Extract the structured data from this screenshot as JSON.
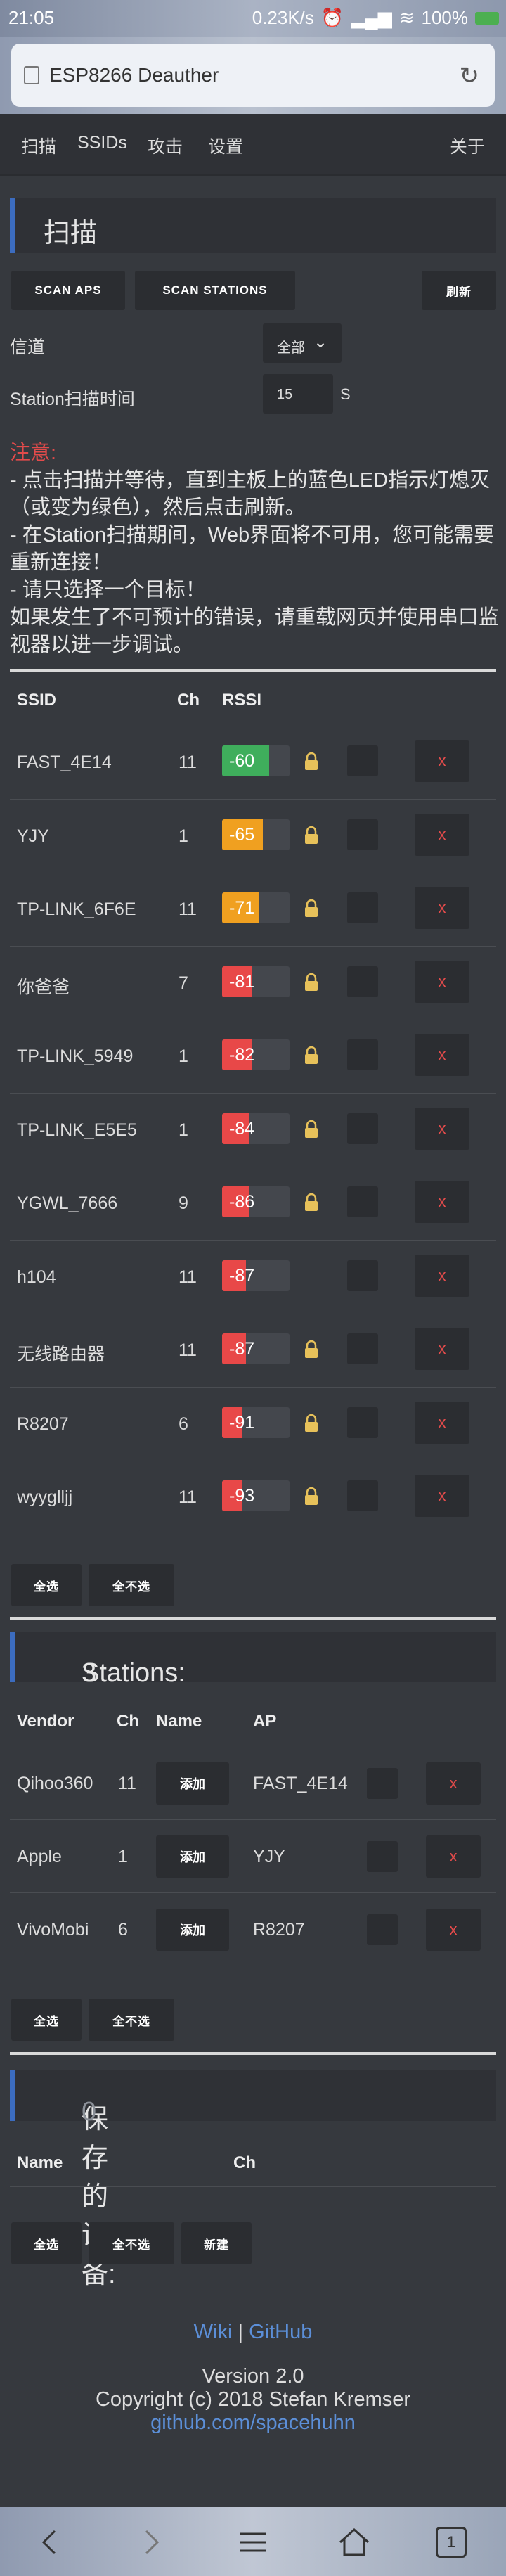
{
  "status": {
    "time": "21:05",
    "speed": "0.23K/s",
    "battery": "100%"
  },
  "browser": {
    "site_title": "ESP8266 Deauther"
  },
  "nav": {
    "scan": "扫描",
    "ssids": "SSIDs",
    "attack": "攻击",
    "settings": "设置",
    "about": "关于"
  },
  "scan_section": {
    "title": "扫描"
  },
  "buttons": {
    "scan_aps": "SCAN APS",
    "scan_stations": "SCAN STATIONS",
    "reload": "刷新",
    "select_all": "全选",
    "deselect_all": "全不选",
    "add_new": "新建"
  },
  "channel": {
    "label": "信道",
    "value": "全部"
  },
  "station_time": {
    "label": "Station扫描时间",
    "value": "15",
    "unit": "S"
  },
  "notice": {
    "heading": "注意:",
    "line1": "- 点击扫描并等待，直到主板上的蓝色LED指示灯熄灭（或变为绿色），然后点击刷新。",
    "line2": "- 在Station扫描期间，Web界面将不可用，您可能需要重新连接！",
    "line3": "- 请只选择一个目标！",
    "line4": "如果发生了不可预计的错误，请重载网页并使用串口监视器以进一步调试。"
  },
  "ap_table": {
    "headers": {
      "ssid": "SSID",
      "ch": "Ch",
      "rssi": "RSSI"
    },
    "rows": [
      {
        "ssid": "FAST_4E14",
        "ch": "11",
        "rssi": "-60",
        "color": "#3fae5c",
        "level": 0.7,
        "lock": true
      },
      {
        "ssid": "YJY",
        "ch": "1",
        "rssi": "-65",
        "color": "#f0a020",
        "level": 0.6,
        "lock": true
      },
      {
        "ssid": "TP-LINK_6F6E",
        "ch": "11",
        "rssi": "-71",
        "color": "#f0a020",
        "level": 0.55,
        "lock": true
      },
      {
        "ssid": "你爸爸",
        "ch": "7",
        "rssi": "-81",
        "color": "#e84848",
        "level": 0.45,
        "lock": true
      },
      {
        "ssid": "TP-LINK_5949",
        "ch": "1",
        "rssi": "-82",
        "color": "#e84848",
        "level": 0.45,
        "lock": true
      },
      {
        "ssid": "TP-LINK_E5E5",
        "ch": "1",
        "rssi": "-84",
        "color": "#e84848",
        "level": 0.4,
        "lock": true
      },
      {
        "ssid": "YGWL_7666",
        "ch": "9",
        "rssi": "-86",
        "color": "#e84848",
        "level": 0.4,
        "lock": true
      },
      {
        "ssid": "h104",
        "ch": "11",
        "rssi": "-87",
        "color": "#e84848",
        "level": 0.35,
        "lock": false
      },
      {
        "ssid": "无线路由器",
        "ch": "11",
        "rssi": "-87",
        "color": "#e84848",
        "level": 0.35,
        "lock": true
      },
      {
        "ssid": "R8207",
        "ch": "6",
        "rssi": "-91",
        "color": "#e84848",
        "level": 0.3,
        "lock": true
      },
      {
        "ssid": "wyyglljj",
        "ch": "11",
        "rssi": "-93",
        "color": "#e84848",
        "level": 0.3,
        "lock": true
      }
    ],
    "remove": "x"
  },
  "stations": {
    "title": "Stations:",
    "count": "3",
    "headers": {
      "vendor": "Vendor",
      "ch": "Ch",
      "name": "Name",
      "ap": "AP"
    },
    "add": "添加",
    "rows": [
      {
        "vendor": "Qihoo360",
        "ch": "11",
        "ap": "FAST_4E14"
      },
      {
        "vendor": "Apple",
        "ch": "1",
        "ap": "YJY"
      },
      {
        "vendor": "VivoMobi",
        "ch": "6",
        "ap": "R8207"
      }
    ]
  },
  "saved": {
    "title": "保存的设备:",
    "count": "0",
    "headers": {
      "name": "Name",
      "ch": "Ch"
    }
  },
  "footer": {
    "wiki": "Wiki",
    "sep": "|",
    "github": "GitHub",
    "version": "Version 2.0",
    "copyright": "Copyright (c) 2018 Stefan Kremser",
    "repo": "github.com/spacehuhn"
  },
  "tabs": {
    "count": "1"
  },
  "colors": {
    "accent": "#3c6cbf",
    "danger": "#e34b4b",
    "link": "#5c8fd8"
  }
}
